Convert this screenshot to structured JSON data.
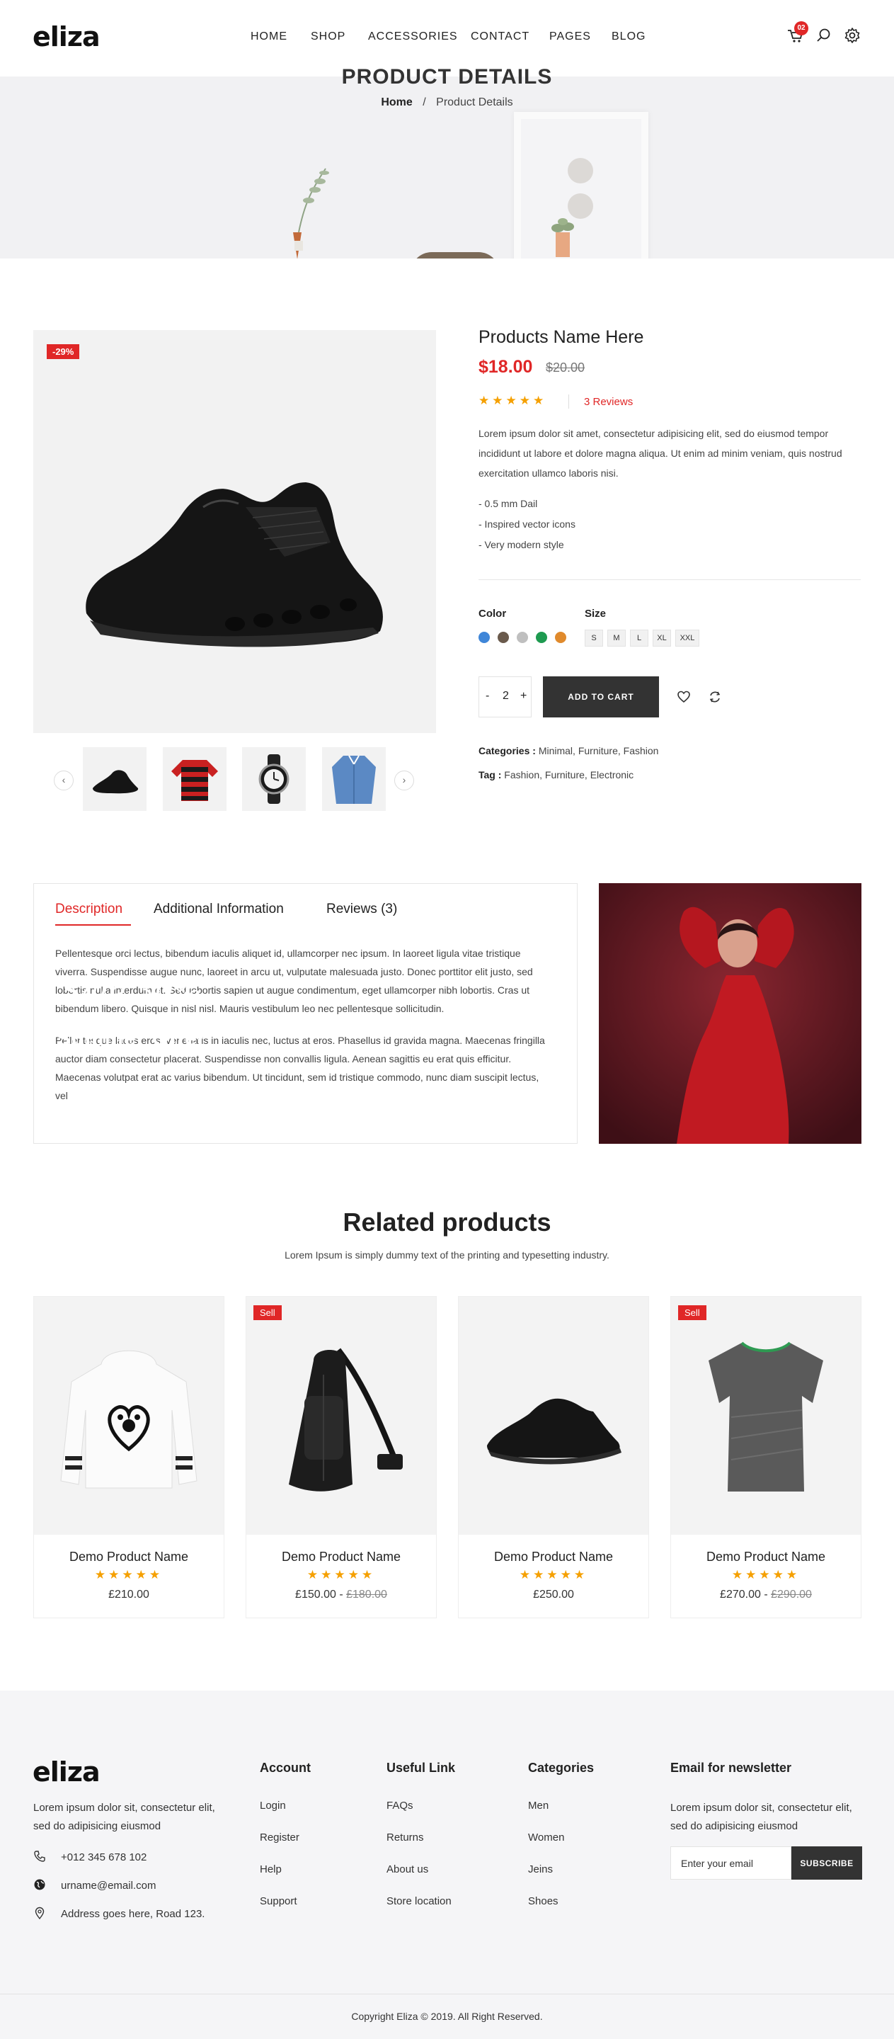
{
  "header": {
    "logo": "eliza",
    "nav": [
      "HOME",
      "SHOP",
      "ACCESSORIES",
      "CONTACT",
      "PAGES",
      "BLOG"
    ],
    "cart_count": "02",
    "icons": [
      "cart-icon",
      "search-icon",
      "settings-icon"
    ]
  },
  "banner": {
    "title": "PRODUCT DETAILS",
    "breadcrumb_home": "Home",
    "breadcrumb_sep": "/",
    "breadcrumb_current": "Product Details"
  },
  "product": {
    "discount": "-29%",
    "name": "Products Name Here",
    "price": "$18.00",
    "old_price": "$20.00",
    "rating": 5,
    "stars": "★★★★★",
    "reviews_text": "3 Reviews",
    "description": "Lorem ipsum dolor sit amet, consectetur adipisicing elit, sed do eiusmod tempor incididunt ut labore et dolore magna aliqua. Ut enim ad minim veniam, quis nostrud exercitation ullamco laboris nisi.",
    "features": [
      "- 0.5 mm Dail",
      "- Inspired vector icons",
      "- Very modern style"
    ],
    "color_label": "Color",
    "colors": [
      "#3f86d8",
      "#6a5a4c",
      "#bfbfbf",
      "#1e9a50",
      "#e08a2c"
    ],
    "size_label": "Size",
    "sizes": [
      "S",
      "M",
      "L",
      "XL",
      "XXL"
    ],
    "qty_minus": "-",
    "qty_value": "2",
    "qty_plus": "+",
    "add_to_cart": "ADD TO CART",
    "categories_label": "Categories :",
    "categories": [
      "Minimal,",
      "Furniture,",
      "Fashion"
    ],
    "tag_label": "Tag :",
    "tags": [
      "Fashion,",
      "Furniture,",
      "Electronic"
    ],
    "thumb_prev": "‹",
    "thumb_next": "›"
  },
  "tabs": {
    "items": [
      "Description",
      "Additional Information",
      "Reviews (3)"
    ],
    "active": 0,
    "para1": "Pellentesque orci lectus, bibendum iaculis aliquet id, ullamcorper nec ipsum. In laoreet ligula vitae tristique viverra. Suspendisse augue nunc, laoreet in arcu ut, vulputate malesuada justo. Donec porttitor elit justo, sed lobortis nulla interdum et. Sed lobortis sapien ut augue condimentum, eget ullamcorper nibh lobortis. Cras ut bibendum libero. Quisque in nisl nisl. Mauris vestibulum leo nec pellentesque sollicitudin.",
    "para2": "Pellentesque lacus eros, venenatis in iaculis nec, luctus at eros. Phasellus id gravida magna. Maecenas fringilla auctor diam consectetur placerat. Suspendisse non convallis ligula. Aenean sagittis eu erat quis efficitur. Maecenas volutpat erat ac varius bibendum. Ut tincidunt, sem id tristique commodo, nunc diam suscipit lectus, vel"
  },
  "promo": {
    "sale": "Sale 30%",
    "offer": "Summer Offer"
  },
  "related": {
    "title": "Related products",
    "subtitle": "Lorem Ipsum is simply dummy text of the printing and typesetting industry.",
    "sell_badge": "Sell",
    "products": [
      {
        "name": "Demo Product Name",
        "stars": "★★★★★",
        "price": "£210.00",
        "old_price": "",
        "sell": false
      },
      {
        "name": "Demo Product Name",
        "stars": "★★★★★",
        "price": "£150.00 -",
        "old_price": "£180.00",
        "sell": true
      },
      {
        "name": "Demo Product Name",
        "stars": "★★★★★",
        "price": "£250.00",
        "old_price": "",
        "sell": false
      },
      {
        "name": "Demo Product Name",
        "stars": "★★★★★",
        "price": "£270.00 -",
        "old_price": "£290.00",
        "sell": true
      }
    ]
  },
  "footer": {
    "logo": "eliza",
    "about": "Lorem ipsum dolor sit, consectetur elit, sed do adipisicing eiusmod",
    "phone": "+012 345 678 102",
    "email": "urname@email.com",
    "address": "Address goes here, Road 123.",
    "account_title": "Account",
    "account_links": [
      "Login",
      "Register",
      "Help",
      "Support"
    ],
    "useful_title": "Useful Link",
    "useful_links": [
      "FAQs",
      "Returns",
      "About us",
      "Store location"
    ],
    "categories_title": "Categories",
    "category_links": [
      "Men",
      "Women",
      "Jeins",
      "Shoes"
    ],
    "newsletter_title": "Email for newsletter",
    "newsletter_text": "Lorem ipsum dolor sit, consectetur elit, sed do adipisicing eiusmod",
    "newsletter_placeholder": "Enter your email",
    "subscribe": "SUBSCRIBE",
    "copyright": "Copyright Eliza © 2019. All Right Reserved."
  }
}
